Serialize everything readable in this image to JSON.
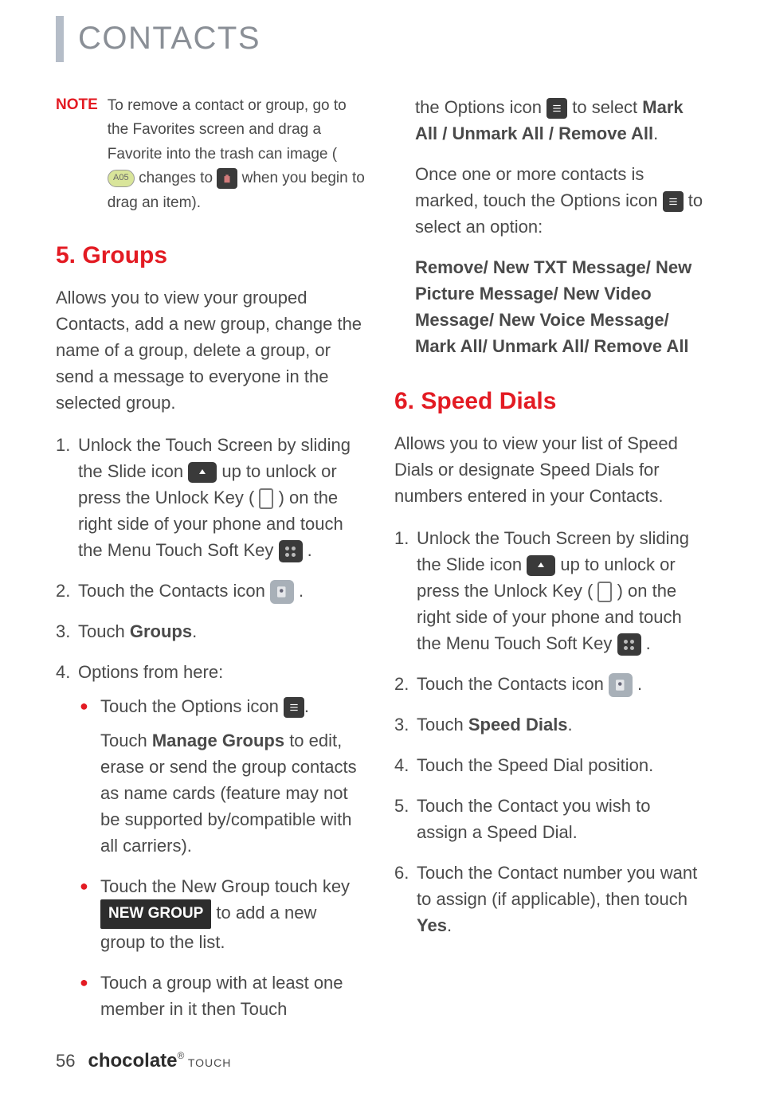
{
  "page": {
    "title": "CONTACTS",
    "number": "56",
    "brand": "chocolate",
    "brand_reg": "®",
    "brand_sub": "TOUCH"
  },
  "note": {
    "label": "NOTE",
    "text_before": "To remove a contact or group, go to the Favorites screen and drag a Favorite into the trash can image ( ",
    "text_mid": " changes to ",
    "text_after": " when you begin to drag an item)."
  },
  "section5": {
    "heading": "5. Groups",
    "intro": "Allows you to view your grouped Contacts, add a new group, change the name of a group, delete a group, or send a message to everyone in the selected group.",
    "step1_a": "Unlock the Touch Screen by sliding the Slide icon ",
    "step1_b": " up to unlock or press the Unlock Key ( ",
    "step1_c": " ) on the right side of your phone and touch the Menu Touch Soft Key ",
    "step1_d": " .",
    "step2_a": "Touch the Contacts icon ",
    "step2_b": ".",
    "step3_a": "Touch ",
    "step3_b": "Groups",
    "step3_c": ".",
    "step4": "Options from here:",
    "bullet1_a": "Touch the Options icon ",
    "bullet1_b": ".",
    "bullet1_para_a": "Touch ",
    "bullet1_para_b": "Manage Groups",
    "bullet1_para_c": " to edit, erase or send the group contacts as name cards (feature may not be supported by/compatible with all carriers).",
    "bullet2_a": "Touch the New Group touch key ",
    "bullet2_btn": "NEW GROUP",
    "bullet2_b": " to add a new group to the list.",
    "bullet3": "Touch a group with at least one member in it then Touch"
  },
  "col2": {
    "cont1_a": "the Options icon ",
    "cont1_b": " to select ",
    "cont1_c": "Mark All / Unmark All / Remove All",
    "cont1_d": ".",
    "cont2_a": "Once one or more contacts is marked, touch the Options icon ",
    "cont2_b": " to select an option:",
    "cont3": "Remove/ New TXT Message/ New Picture Message/ New Video Message/ New Voice Message/ Mark All/ Unmark All/ Remove All"
  },
  "section6": {
    "heading": "6. Speed Dials",
    "intro": "Allows you to view your list of Speed Dials or designate Speed Dials for numbers entered in your Contacts.",
    "step1_a": "Unlock the Touch Screen by sliding the Slide icon ",
    "step1_b": " up to unlock or press the Unlock Key ( ",
    "step1_c": " ) on the right side of your phone and touch the Menu Touch Soft Key ",
    "step1_d": " .",
    "step2_a": "Touch the Contacts icon ",
    "step2_b": ".",
    "step3_a": "Touch ",
    "step3_b": "Speed Dials",
    "step3_c": ".",
    "step4": "Touch the Speed Dial position.",
    "step5": "Touch the Contact you wish to assign a Speed Dial.",
    "step6_a": "Touch the Contact number you want to assign (if applicable), then touch ",
    "step6_b": "Yes",
    "step6_c": "."
  }
}
